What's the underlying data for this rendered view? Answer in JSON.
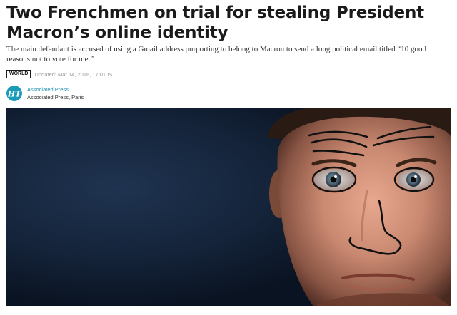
{
  "article": {
    "headline": "Two Frenchmen on trial for stealing President Macron’s online identity",
    "standfirst": "The main defendant is accused of using a Gmail address purporting to belong to Macron to send a long political email titled “10 good reasons not to vote for me.”",
    "section_tag": "WORLD",
    "updated": "Updated: Mar 14, 2018, 17:01 IST",
    "author": "Associated Press",
    "author_location": "Associated Press, Paris",
    "publisher_logo_text": "HT",
    "photo_description_icon": "portrait-photo-with-doodles"
  },
  "colors": {
    "headline": "#1a1a1a",
    "author_link": "#1a8fb0",
    "logo_bg": "#1a9bb8",
    "updated_text": "#9a9a9a"
  }
}
